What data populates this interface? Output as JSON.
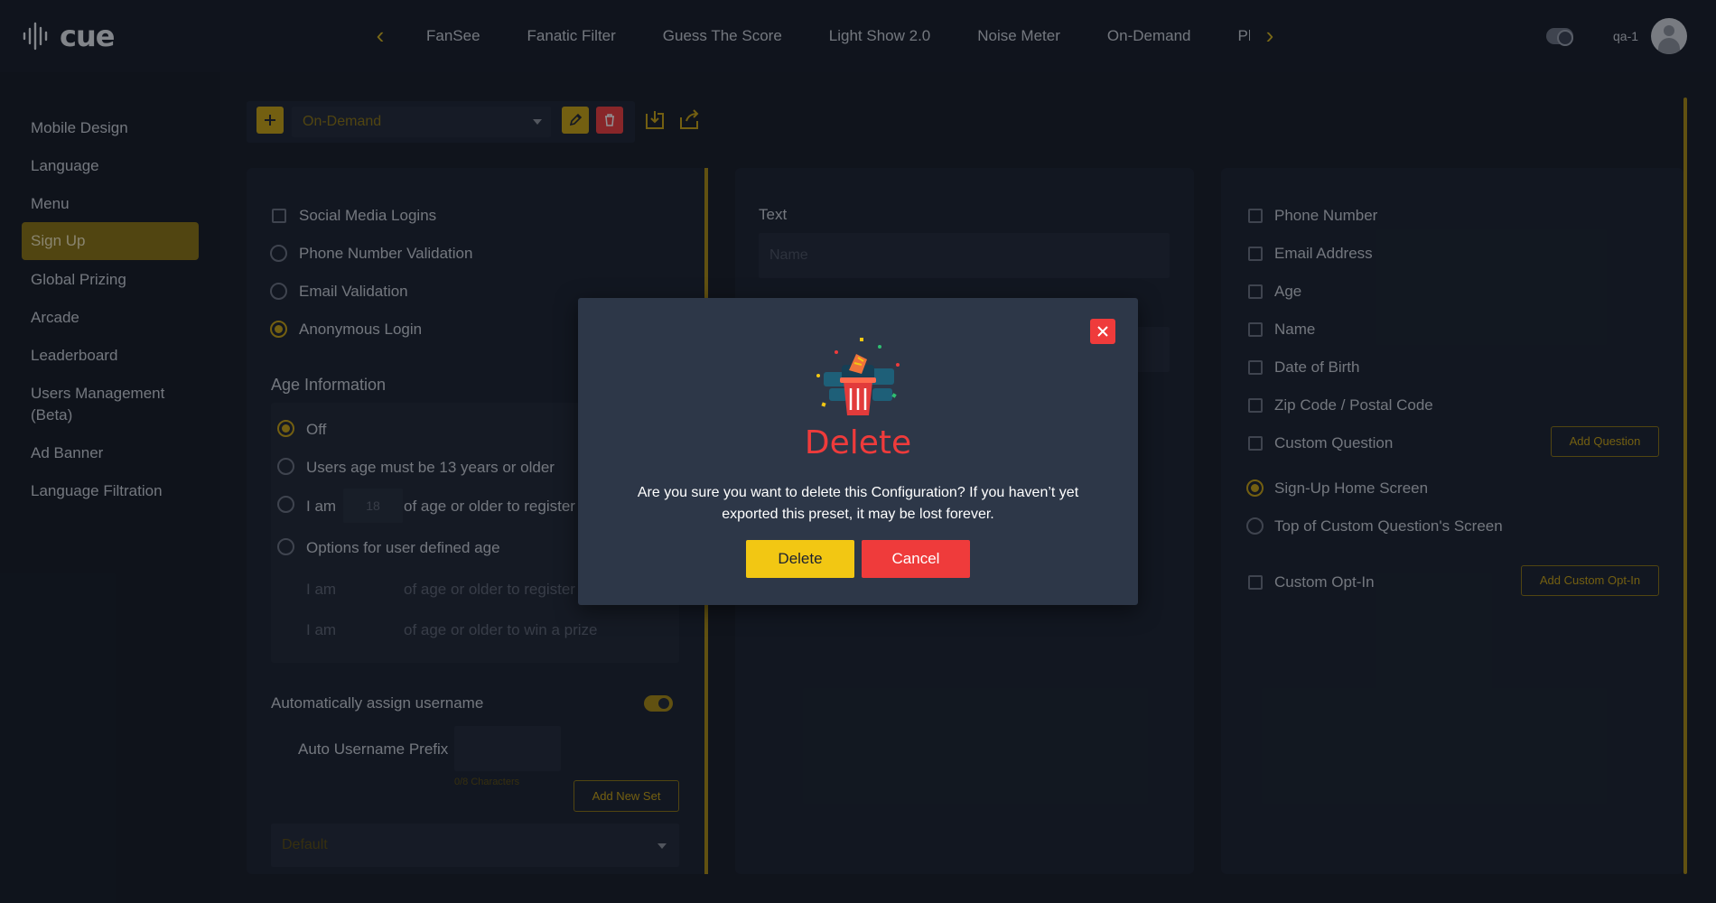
{
  "header": {
    "logo_text": "cue",
    "nav_tabs": [
      "FanSee",
      "Fanatic Filter",
      "Guess The Score",
      "Light Show 2.0",
      "Noise Meter",
      "On-Demand",
      "Ple"
    ],
    "username": "qa-1"
  },
  "sidebar": {
    "items": [
      {
        "label": "Mobile Design"
      },
      {
        "label": "Language"
      },
      {
        "label": "Menu"
      },
      {
        "label": "Sign Up",
        "active": true
      },
      {
        "label": "Global Prizing"
      },
      {
        "label": "Arcade"
      },
      {
        "label": "Leaderboard"
      },
      {
        "label": "Users Management",
        "label2": "(Beta)"
      },
      {
        "label": "Ad Banner"
      },
      {
        "label": "Language Filtration"
      }
    ]
  },
  "toolbar": {
    "preset_value": "On-Demand"
  },
  "left_panel": {
    "login_options": [
      {
        "label": "Social Media Logins",
        "kind": "checkbox",
        "checked": false
      },
      {
        "label": "Phone Number Validation",
        "kind": "radio",
        "checked": false
      },
      {
        "label": "Email Validation",
        "kind": "radio",
        "checked": false
      },
      {
        "label": "Anonymous Login",
        "kind": "radio",
        "checked": true
      }
    ],
    "age_heading": "Age Information",
    "age_options": {
      "off": "Off",
      "min13": "Users age must be 13 years or older",
      "i_am": "I am",
      "age_placeholder": "18",
      "of_age_register": "of age or older to register",
      "user_defined": "Options for user defined age",
      "sub_i_am_1": "I am",
      "sub_register": "of age or older to register",
      "sub_i_am_2": "I am",
      "sub_prize": "of age or older to win a prize"
    },
    "auto_username_label": "Automatically assign username",
    "auto_username_on": true,
    "prefix_label": "Auto Username Prefix",
    "prefix_counter": "0/8 Characters",
    "add_new_set": "Add New Set",
    "set_select_value": "Default"
  },
  "middle_panel": {
    "text_label": "Text",
    "name_placeholder": "Name"
  },
  "right_panel": {
    "fields": [
      {
        "label": "Phone Number",
        "checked": false
      },
      {
        "label": "Email Address",
        "checked": false
      },
      {
        "label": "Age",
        "checked": false
      },
      {
        "label": "Name",
        "checked": false
      },
      {
        "label": "Date of Birth",
        "checked": false
      },
      {
        "label": "Zip Code / Postal Code",
        "checked": false
      },
      {
        "label": "Custom Question",
        "checked": false
      }
    ],
    "add_question": "Add Question",
    "placement": [
      {
        "label": "Sign-Up Home Screen",
        "checked": true
      },
      {
        "label": "Top of Custom Question's Screen",
        "checked": false
      }
    ],
    "custom_optin": "Custom Opt-In",
    "add_custom_optin": "Add Custom Opt-In"
  },
  "modal": {
    "title": "Delete",
    "message": "Are you sure you want to delete this Configuration? If you haven’t yet exported this preset, it may be lost forever.",
    "delete_label": "Delete",
    "cancel_label": "Cancel"
  },
  "colors": {
    "accent": "#c9a210",
    "danger": "#ef3b3b",
    "confirm": "#f2c713"
  }
}
